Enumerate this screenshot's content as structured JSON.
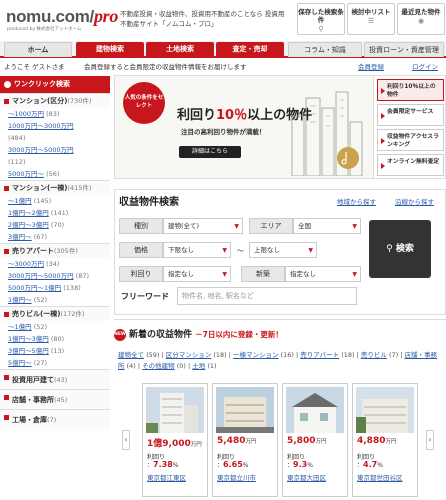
{
  "header": {
    "logo_main": "nomu.com/",
    "logo_pro": "pro",
    "logo_sub": "produced by 株式会社アットホーム",
    "tagline": "不動産投資・収益物件、投資用不動産のことなら 投資用不動産サイト「ノムコム・プロ」",
    "buttons": [
      {
        "label": "保存した検索条件",
        "icon": "search-icon"
      },
      {
        "label": "検討中リスト",
        "icon": "list-icon"
      },
      {
        "label": "最近見た物件",
        "icon": "eye-icon"
      }
    ]
  },
  "nav": {
    "tabs": [
      "ホーム",
      "建物検索",
      "土地検索",
      "査定・売却",
      "コラム・知識",
      "投資ローン・資産管理"
    ]
  },
  "subbar": {
    "welcome": "ようこそ ゲストさま",
    "note": "会員登録すると会員限定の収益物件情報をお届けします",
    "register": "会員登録",
    "login": "ログイン"
  },
  "sidebar": {
    "head": "ワンクリック検索",
    "sections": [
      {
        "title": "マンション(区分)",
        "count": "(730件)",
        "items": [
          {
            "label": "～1000万円",
            "count": "(83)"
          },
          {
            "label": "1000万円～3000万円",
            "count": "(484)"
          },
          {
            "label": "3000万円～5000万円",
            "count": "(112)"
          },
          {
            "label": "5000万円～",
            "count": "(56)"
          }
        ]
      },
      {
        "title": "マンション(一棟)",
        "count": "(415件)",
        "items": [
          {
            "label": "～1億円",
            "count": "(145)"
          },
          {
            "label": "1億円～2億円",
            "count": "(141)"
          },
          {
            "label": "2億円～3億円",
            "count": "(70)"
          },
          {
            "label": "3億円～",
            "count": "(67)"
          }
        ]
      },
      {
        "title": "売りアパート",
        "count": "(305件)",
        "items": [
          {
            "label": "～3000万円",
            "count": "(34)"
          },
          {
            "label": "3000万円～5000万円",
            "count": "(87)"
          },
          {
            "label": "5000万円～1億円",
            "count": "(138)"
          },
          {
            "label": "1億円～",
            "count": "(52)"
          }
        ]
      },
      {
        "title": "売りビル(一棟)",
        "count": "(172件)",
        "items": [
          {
            "label": "～1億円",
            "count": "(52)"
          },
          {
            "label": "1億円～3億円",
            "count": "(80)"
          },
          {
            "label": "3億円～5億円",
            "count": "(13)"
          },
          {
            "label": "5億円～",
            "count": "(27)"
          }
        ]
      },
      {
        "title": "投資用戸建て",
        "count": "(43)",
        "items": []
      },
      {
        "title": "店舗・事務所",
        "count": "(45)",
        "items": []
      },
      {
        "title": "工場・倉庫",
        "count": "(7)",
        "items": []
      }
    ]
  },
  "banner": {
    "badge": "人気の条件をセレクト",
    "title_pre": "利回り",
    "title_red": "10％",
    "title_post": "以上の物件",
    "sub": "注目の高利回り物件が満載！",
    "button": "詳細はこちら",
    "menu": [
      "利回り10％以上の物件",
      "会員限定サービス",
      "収益物件アクセスランキング",
      "オンライン無料査定"
    ]
  },
  "search": {
    "title": "収益物件検索",
    "map_link": "地域から探す",
    "line_link": "沿線から探す",
    "labels": {
      "type": "種別",
      "area": "エリア",
      "price": "価格",
      "yield": "利回り",
      "age": "新築"
    },
    "values": {
      "type": "建物(全て)",
      "area": "全国",
      "price_min": "下限なし",
      "price_max": "上限なし",
      "yield": "指定なし",
      "age": "指定なし"
    },
    "tilde": "～",
    "button": "検索",
    "keyword_label": "フリーワード",
    "keyword_placeholder": "物件名, 地名, 駅名など"
  },
  "new_listings": {
    "badge": "NEW",
    "title": "新着の収益物件",
    "subtitle": "－7日以内に登録・更新！",
    "categories": [
      {
        "label": "建物全て",
        "count": "(59)"
      },
      {
        "label": "区分マンション",
        "count": "(18)"
      },
      {
        "label": "一棟マンション",
        "count": "(16)"
      },
      {
        "label": "売りアパート",
        "count": "(18)"
      },
      {
        "label": "売りビル",
        "count": "(7)"
      },
      {
        "label": "店舗・事務所",
        "count": "(4)"
      },
      {
        "label": "その他建物",
        "count": "(0)"
      },
      {
        "label": "土地",
        "count": "(1)"
      }
    ],
    "cards": [
      {
        "price": "1億9,000",
        "unit": "万円",
        "yield_label": "利回り",
        "yield": "7.38",
        "pct": "%",
        "location": "東京都江東区"
      },
      {
        "price": "5,480",
        "unit": "万円",
        "yield_label": "利回り",
        "yield": "6.65",
        "pct": "%",
        "location": "東京都立川市"
      },
      {
        "price": "5,800",
        "unit": "万円",
        "yield_label": "利回り",
        "yield": "9.3",
        "pct": "%",
        "location": "東京都大田区"
      },
      {
        "price": "4,880",
        "unit": "万円",
        "yield_label": "利回り",
        "yield": "4.7",
        "pct": "%",
        "location": "東京都世田谷区"
      }
    ]
  },
  "colors": {
    "accent": "#c8161d",
    "link": "#2a5aa8"
  }
}
